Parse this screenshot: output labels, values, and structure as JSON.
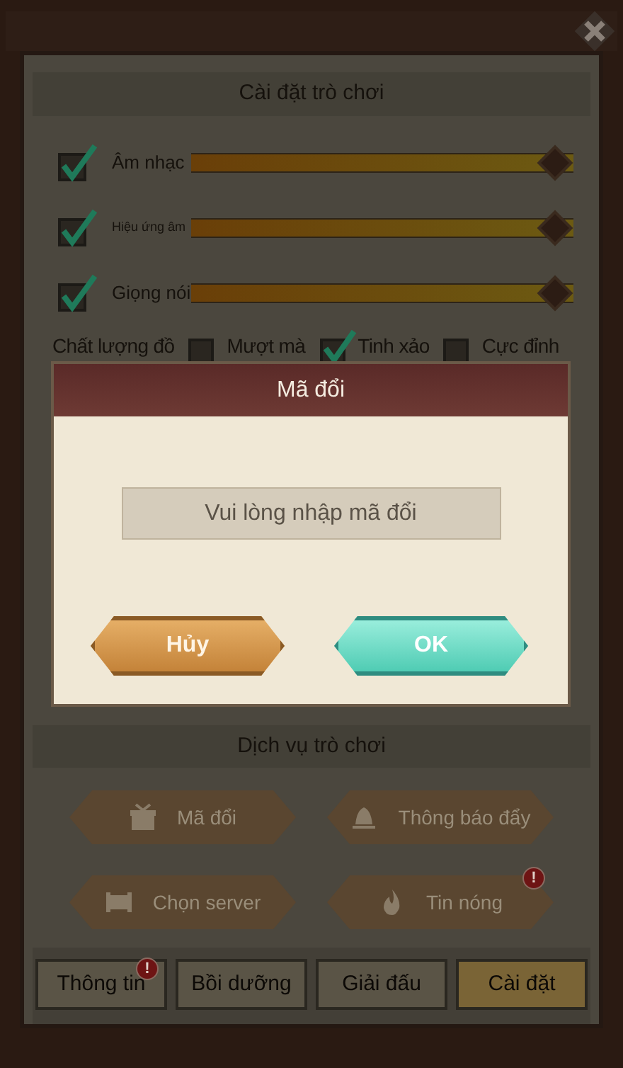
{
  "panel": {
    "title": "Cài đặt trò chơi"
  },
  "audio": [
    {
      "label": "Âm nhạc",
      "checked": true,
      "level": 1
    },
    {
      "label": "Hiệu ứng âm",
      "checked": true,
      "level": 1
    },
    {
      "label": "Giọng nói",
      "checked": true,
      "level": 1
    }
  ],
  "quality": {
    "label": "Chất lượng đồ",
    "options": [
      {
        "label": "Mượt mà",
        "checked": false
      },
      {
        "label": "Tinh xảo",
        "checked": true
      },
      {
        "label": "Cực đỉnh",
        "checked": false
      }
    ]
  },
  "dialog": {
    "title": "Mã đổi",
    "placeholder": "Vui lòng nhập mã đổi",
    "buttons": [
      {
        "label": "Hủy",
        "kind": "cancel"
      },
      {
        "label": "OK",
        "kind": "confirm"
      }
    ]
  },
  "services": {
    "title": "Dịch vụ trò chơi",
    "buttons": [
      {
        "label": "Mã đổi"
      },
      {
        "label": "Thông báo đẩy"
      },
      {
        "label": "Chọn server"
      },
      {
        "label": "Tin nóng",
        "badge": "!"
      }
    ]
  },
  "tabs": [
    {
      "label": "Thông tin",
      "selected": false,
      "badge": "!"
    },
    {
      "label": "Bồi dưỡng",
      "selected": false
    },
    {
      "label": "Giải đấu",
      "selected": false
    },
    {
      "label": "Cài đặt",
      "selected": true
    }
  ]
}
